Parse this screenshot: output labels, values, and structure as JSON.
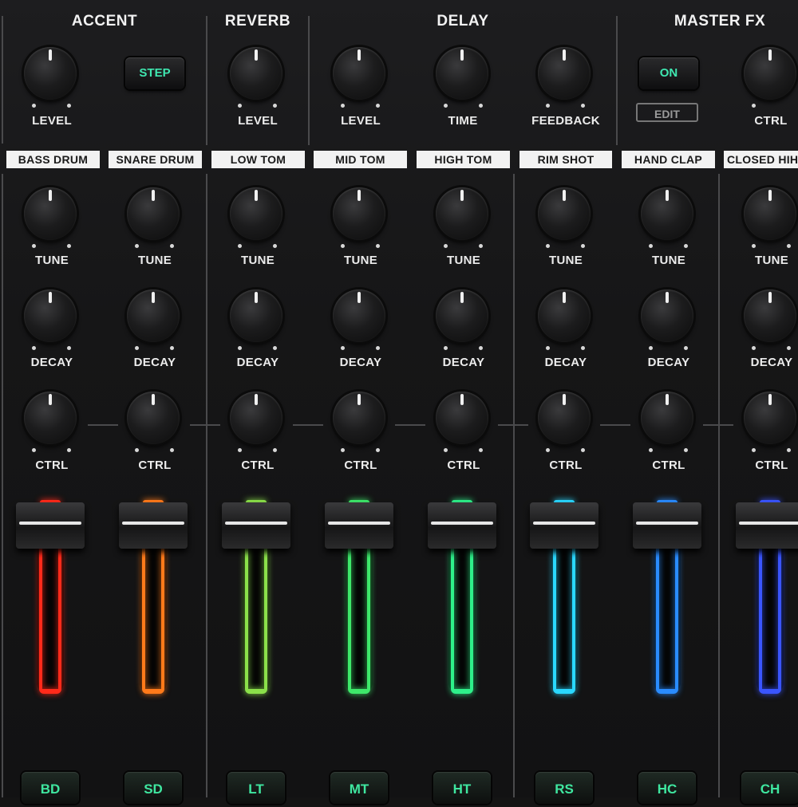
{
  "sections": {
    "accent": "ACCENT",
    "reverb": "REVERB",
    "delay": "DELAY",
    "master_fx": "MASTER FX"
  },
  "top_knob_labels": {
    "accent_level": "LEVEL",
    "reverb_level": "LEVEL",
    "delay_level": "LEVEL",
    "delay_time": "TIME",
    "delay_feedback": "FEEDBACK",
    "master_ctrl": "CTRL"
  },
  "buttons": {
    "step": "STEP",
    "master_on": "ON",
    "master_edit": "EDIT"
  },
  "channels": [
    {
      "name": "BASS DRUM",
      "pad": "BD",
      "color": "#ff2a1a",
      "tune": "TUNE",
      "decay": "DECAY",
      "ctrl": "CTRL"
    },
    {
      "name": "SNARE DRUM",
      "pad": "SD",
      "color": "#ff7a1a",
      "tune": "TUNE",
      "decay": "DECAY",
      "ctrl": "CTRL"
    },
    {
      "name": "LOW TOM",
      "pad": "LT",
      "color": "#8be04a",
      "tune": "TUNE",
      "decay": "DECAY",
      "ctrl": "CTRL"
    },
    {
      "name": "MID TOM",
      "pad": "MT",
      "color": "#3ee86a",
      "tune": "TUNE",
      "decay": "DECAY",
      "ctrl": "CTRL"
    },
    {
      "name": "HIGH TOM",
      "pad": "HT",
      "color": "#2ef08a",
      "tune": "TUNE",
      "decay": "DECAY",
      "ctrl": "CTRL"
    },
    {
      "name": "RIM SHOT",
      "pad": "RS",
      "color": "#2ad8ff",
      "tune": "TUNE",
      "decay": "DECAY",
      "ctrl": "CTRL"
    },
    {
      "name": "HAND CLAP",
      "pad": "HC",
      "color": "#2a8cff",
      "tune": "TUNE",
      "decay": "DECAY",
      "ctrl": "CTRL"
    },
    {
      "name": "CLOSED HIHAT",
      "pad": "CH",
      "color": "#3a55ff",
      "tune": "TUNE",
      "decay": "DECAY",
      "ctrl": "CTRL"
    }
  ]
}
